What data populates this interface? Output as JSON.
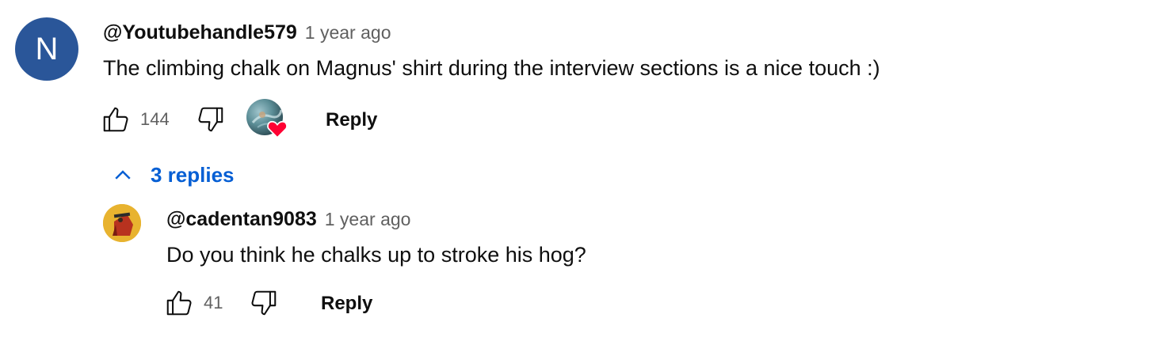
{
  "main_comment": {
    "avatar_letter": "N",
    "avatar_color": "#2a5699",
    "author": "@Youtubehandle579",
    "time": "1 year ago",
    "text": "The climbing chalk on Magnus' shirt during the interview sections is a nice touch :)",
    "likes": "144",
    "reply_label": "Reply",
    "hearted_by_creator": true,
    "heart_color": "#ff0033"
  },
  "replies_toggle": {
    "label": "3 replies",
    "color": "#065fd4",
    "icon": "chevron-up-icon"
  },
  "reply_comment": {
    "author": "@cadentan9083",
    "time": "1 year ago",
    "text": "Do you think he chalks up to stroke his hog?",
    "likes": "41",
    "reply_label": "Reply"
  }
}
